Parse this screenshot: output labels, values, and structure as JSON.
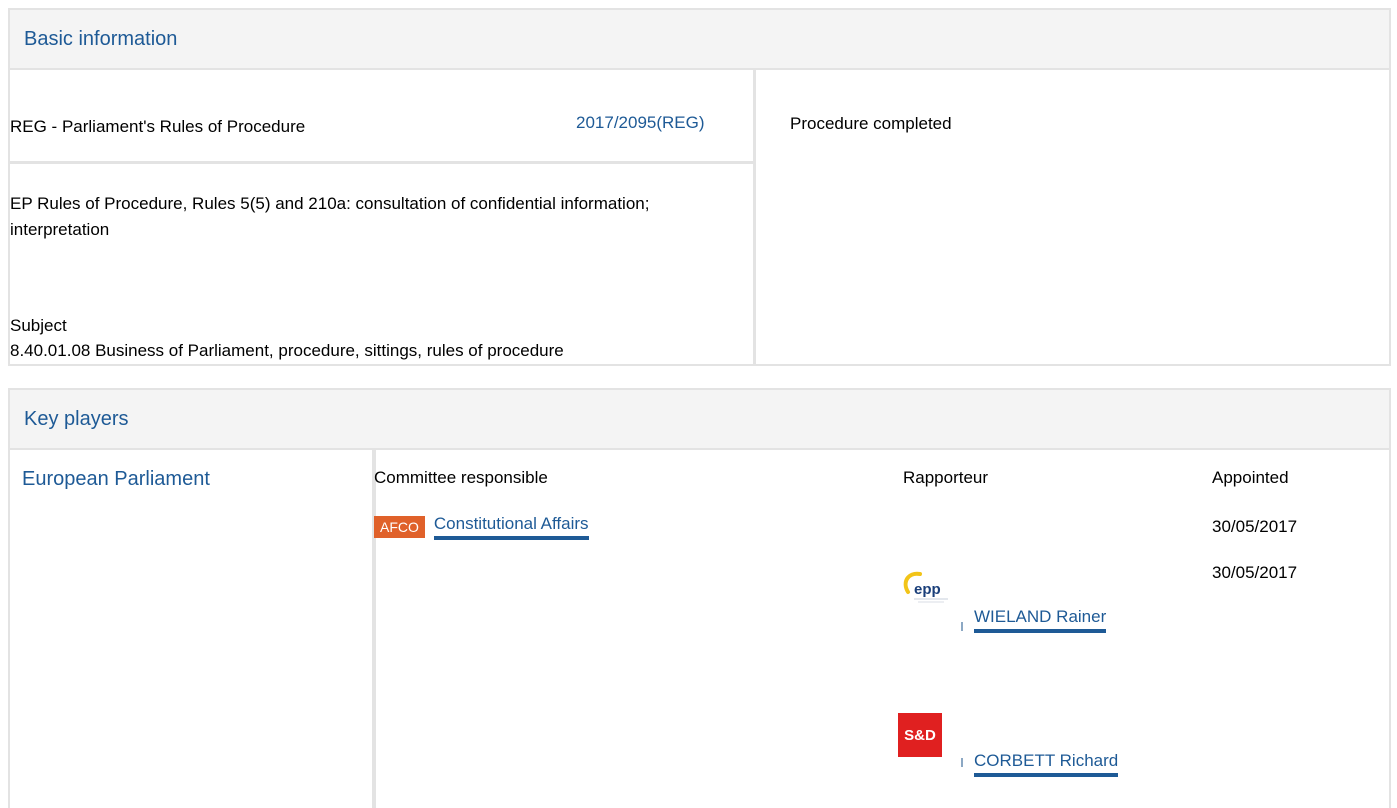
{
  "basic_information": {
    "header": "Basic information",
    "procedure_type": "REG - Parliament's Rules of Procedure",
    "reference": "2017/2095(REG)",
    "status": "Procedure completed",
    "title": "EP Rules of Procedure, Rules 5(5) and 210a: consultation of confidential information; interpretation",
    "subject_label": "Subject",
    "subject_value": "8.40.01.08 Business of Parliament, procedure, sittings, rules of procedure"
  },
  "key_players": {
    "header": "Key players",
    "institution": "European Parliament",
    "columns": {
      "committee": "Committee responsible",
      "rapporteur": "Rapporteur",
      "appointed": "Appointed"
    },
    "committee": {
      "code": "AFCO",
      "name": "Constitutional Affairs",
      "appointed": "30/05/2017"
    },
    "rapporteurs": [
      {
        "name": "WIELAND Rainer",
        "group_logo": "epp",
        "appointed": "30/05/2017"
      },
      {
        "name": "CORBETT Richard",
        "group_logo": "S&D"
      }
    ]
  },
  "colors": {
    "link": "#1e5a96",
    "badge": "#e0612a",
    "border": "#e3e3e3",
    "header_bg": "#f4f4f4",
    "sd_red": "#e02020"
  }
}
